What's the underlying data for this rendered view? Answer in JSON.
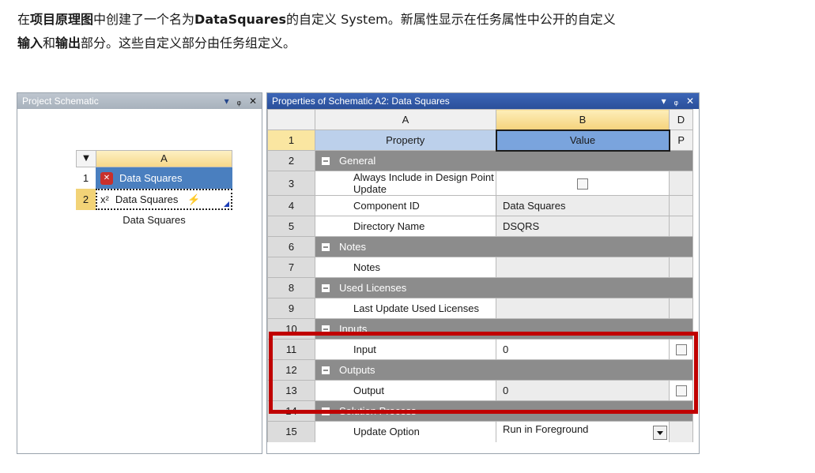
{
  "intro": {
    "l1_pre": "在",
    "l1_bold1": "项目原理图",
    "l1_mid": "中创建了一个名为",
    "l1_bold2": "DataSquares",
    "l1_post": "的自定义 System。新属性显示在任务属性中公开的自定义",
    "l2_bold1": "输入",
    "l2_mid": "和",
    "l2_bold2": "输出",
    "l2_post": "部分。这些自定义部分由任务组定义。"
  },
  "schematic": {
    "title": "Project Schematic",
    "controls": [
      "▾",
      "ᵩ",
      "✕"
    ],
    "column": "A",
    "rows": [
      {
        "num": "1",
        "label": "Data Squares",
        "icon": "system-red-icon"
      },
      {
        "num": "2",
        "label": "Data Squares",
        "icon": "x-squared-icon"
      }
    ],
    "caption": "Data Squares"
  },
  "properties": {
    "title": "Properties of Schematic A2: Data Squares",
    "controls": [
      "▾",
      "ᵩ",
      "✕"
    ],
    "col_a": "A",
    "col_b": "B",
    "col_d": "D",
    "rows": {
      "r1": {
        "n": "1",
        "a": "Property",
        "b": "Value",
        "d": "P"
      },
      "r2": {
        "n": "2",
        "a": "General"
      },
      "r3": {
        "n": "3",
        "a": "Always Include in Design Point Update"
      },
      "r4": {
        "n": "4",
        "a": "Component ID",
        "b": "Data Squares"
      },
      "r5": {
        "n": "5",
        "a": "Directory Name",
        "b": "DSQRS"
      },
      "r6": {
        "n": "6",
        "a": "Notes"
      },
      "r7": {
        "n": "7",
        "a": "Notes"
      },
      "r8": {
        "n": "8",
        "a": "Used Licenses"
      },
      "r9": {
        "n": "9",
        "a": "Last Update Used Licenses"
      },
      "r10": {
        "n": "10",
        "a": "Inputs"
      },
      "r11": {
        "n": "11",
        "a": "Input",
        "b": "0"
      },
      "r12": {
        "n": "12",
        "a": "Outputs"
      },
      "r13": {
        "n": "13",
        "a": "Output",
        "b": "0"
      },
      "r14": {
        "n": "14",
        "a": "Solution Process"
      },
      "r15": {
        "n": "15",
        "a": "Update Option",
        "b": "Run in Foreground"
      }
    }
  },
  "colors": {
    "highlight": "#c00000",
    "selected_row": "#4a7fbf",
    "group_row": "#8c8c8c"
  }
}
